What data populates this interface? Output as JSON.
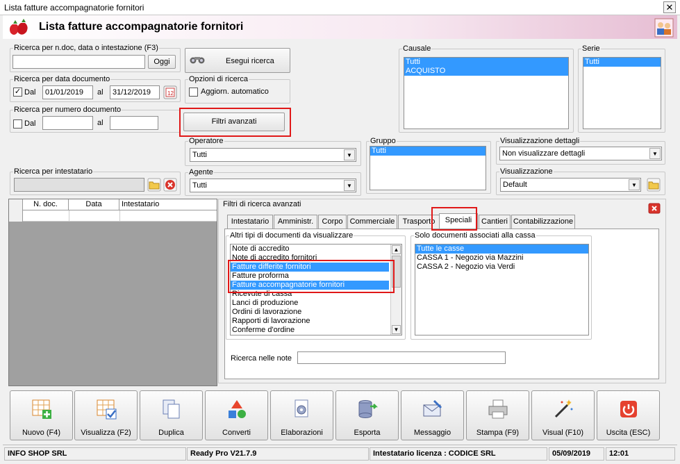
{
  "window": {
    "title": "Lista fatture accompagnatorie fornitori",
    "close": "✕"
  },
  "header": {
    "title": "Lista fatture accompagnatorie fornitori"
  },
  "search_ndoc": {
    "label": "Ricerca per n.doc, data o intestazione (F3)",
    "value": "",
    "button": "Oggi"
  },
  "search_run": {
    "label": "Esegui ricerca"
  },
  "search_date": {
    "label": "Ricerca per data documento",
    "check_label": "Dal",
    "checked": "✓",
    "from": "01/01/2019",
    "to_label": "al",
    "to": "31/12/2019"
  },
  "search_options": {
    "label": "Opzioni di ricerca",
    "auto_update": "Aggiorn. automatico"
  },
  "search_number": {
    "label": "Ricerca per numero documento",
    "check_label": "Dal",
    "to_label": "al"
  },
  "advanced_filters_button": "Filtri avanzati",
  "causale": {
    "label": "Causale",
    "items": [
      "Tutti",
      "ACQUISTO"
    ]
  },
  "serie": {
    "label": "Serie",
    "items": [
      "Tutti"
    ]
  },
  "operatore": {
    "label": "Operatore",
    "value": "Tutti"
  },
  "gruppo": {
    "label": "Gruppo",
    "items": [
      "Tutti"
    ]
  },
  "vis_dettagli": {
    "label": "Visualizzazione dettagli",
    "value": "Non visualizzare dettagli"
  },
  "intestatario": {
    "label": "Ricerca per intestatario",
    "value": ""
  },
  "agente": {
    "label": "Agente",
    "value": "Tutti"
  },
  "visualizzazione": {
    "label": "Visualizzazione",
    "value": "Default"
  },
  "grid": {
    "columns": [
      "N. doc.",
      "Data",
      "Intestatario"
    ]
  },
  "advanced": {
    "label": "Filtri di ricerca avanzati",
    "tabs": [
      "Intestatario",
      "Amministr.",
      "Corpo",
      "Commerciale",
      "Trasporto",
      "Speciali",
      "Cantieri",
      "Contabilizzazione"
    ],
    "active_tab": "Speciali",
    "other_docs": {
      "label": "Altri tipi di documenti da visualizzare",
      "items": [
        "Note di accredito",
        "Note di accredito fornitori",
        "Fatture differite fornitori",
        "Fatture proforma",
        "Fatture accompagnatorie fornitori",
        "Ricevute di cassa",
        "Lanci di produzione",
        "Ordini di lavorazione",
        "Rapporti di lavorazione",
        "Conferme d'ordine"
      ]
    },
    "cash_docs": {
      "label": "Solo documenti associati alla cassa",
      "items": [
        "Tutte le casse",
        "CASSA 1 - Negozio via Mazzini",
        "CASSA 2 - Negozio via Verdi"
      ]
    },
    "notes": {
      "label": "Ricerca nelle note",
      "value": ""
    }
  },
  "toolbar": [
    "Nuovo (F4)",
    "Visualizza (F2)",
    "Duplica",
    "Converti",
    "Elaborazioni",
    "Esporta",
    "Messaggio",
    "Stampa (F9)",
    "Visual (F10)",
    "Uscita (ESC)"
  ],
  "status": {
    "company": "INFO SHOP SRL",
    "version": "Ready Pro V21.7.9",
    "license": "Intestatario licenza : CODICE SRL",
    "date": "05/09/2019",
    "time": "12:01"
  },
  "colors": {
    "selection": "#3399ff",
    "highlight_box": "#e01818",
    "header_pink": "#e6bdd3"
  }
}
